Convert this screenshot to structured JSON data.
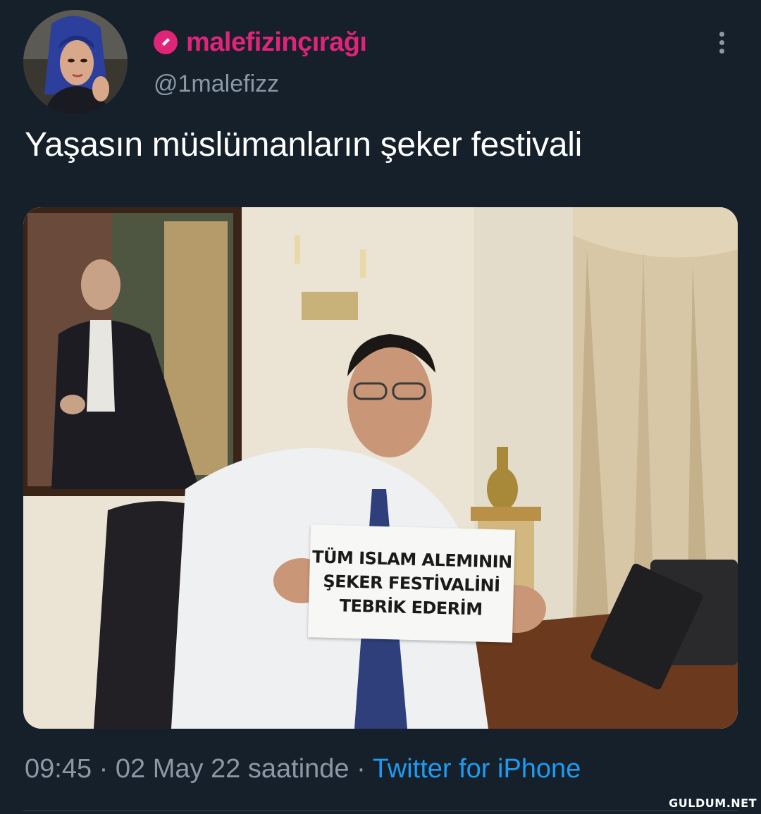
{
  "tweet": {
    "display_name": "malefizinçırağı",
    "handle": "@1malefizz",
    "text": "Yaşasın müslümanların şeker festivali",
    "time": "09:45",
    "separator": " · ",
    "date": "02 May 22 saatinde",
    "source": "Twitter for iPhone"
  },
  "icons": {
    "name_badge": "pencil-badge-icon",
    "more": "more-vertical-icon"
  },
  "media": {
    "sign_lines": [
      "TÜM ISLAM ALEMININ",
      "ŞEKER FESTİVALİNİ",
      "TEBRİK EDERİM"
    ]
  },
  "watermark": "GULDUM.NET",
  "colors": {
    "background": "#15202b",
    "name": "#e0247a",
    "secondary_text": "#8b98a5",
    "link": "#1d9bf0"
  }
}
